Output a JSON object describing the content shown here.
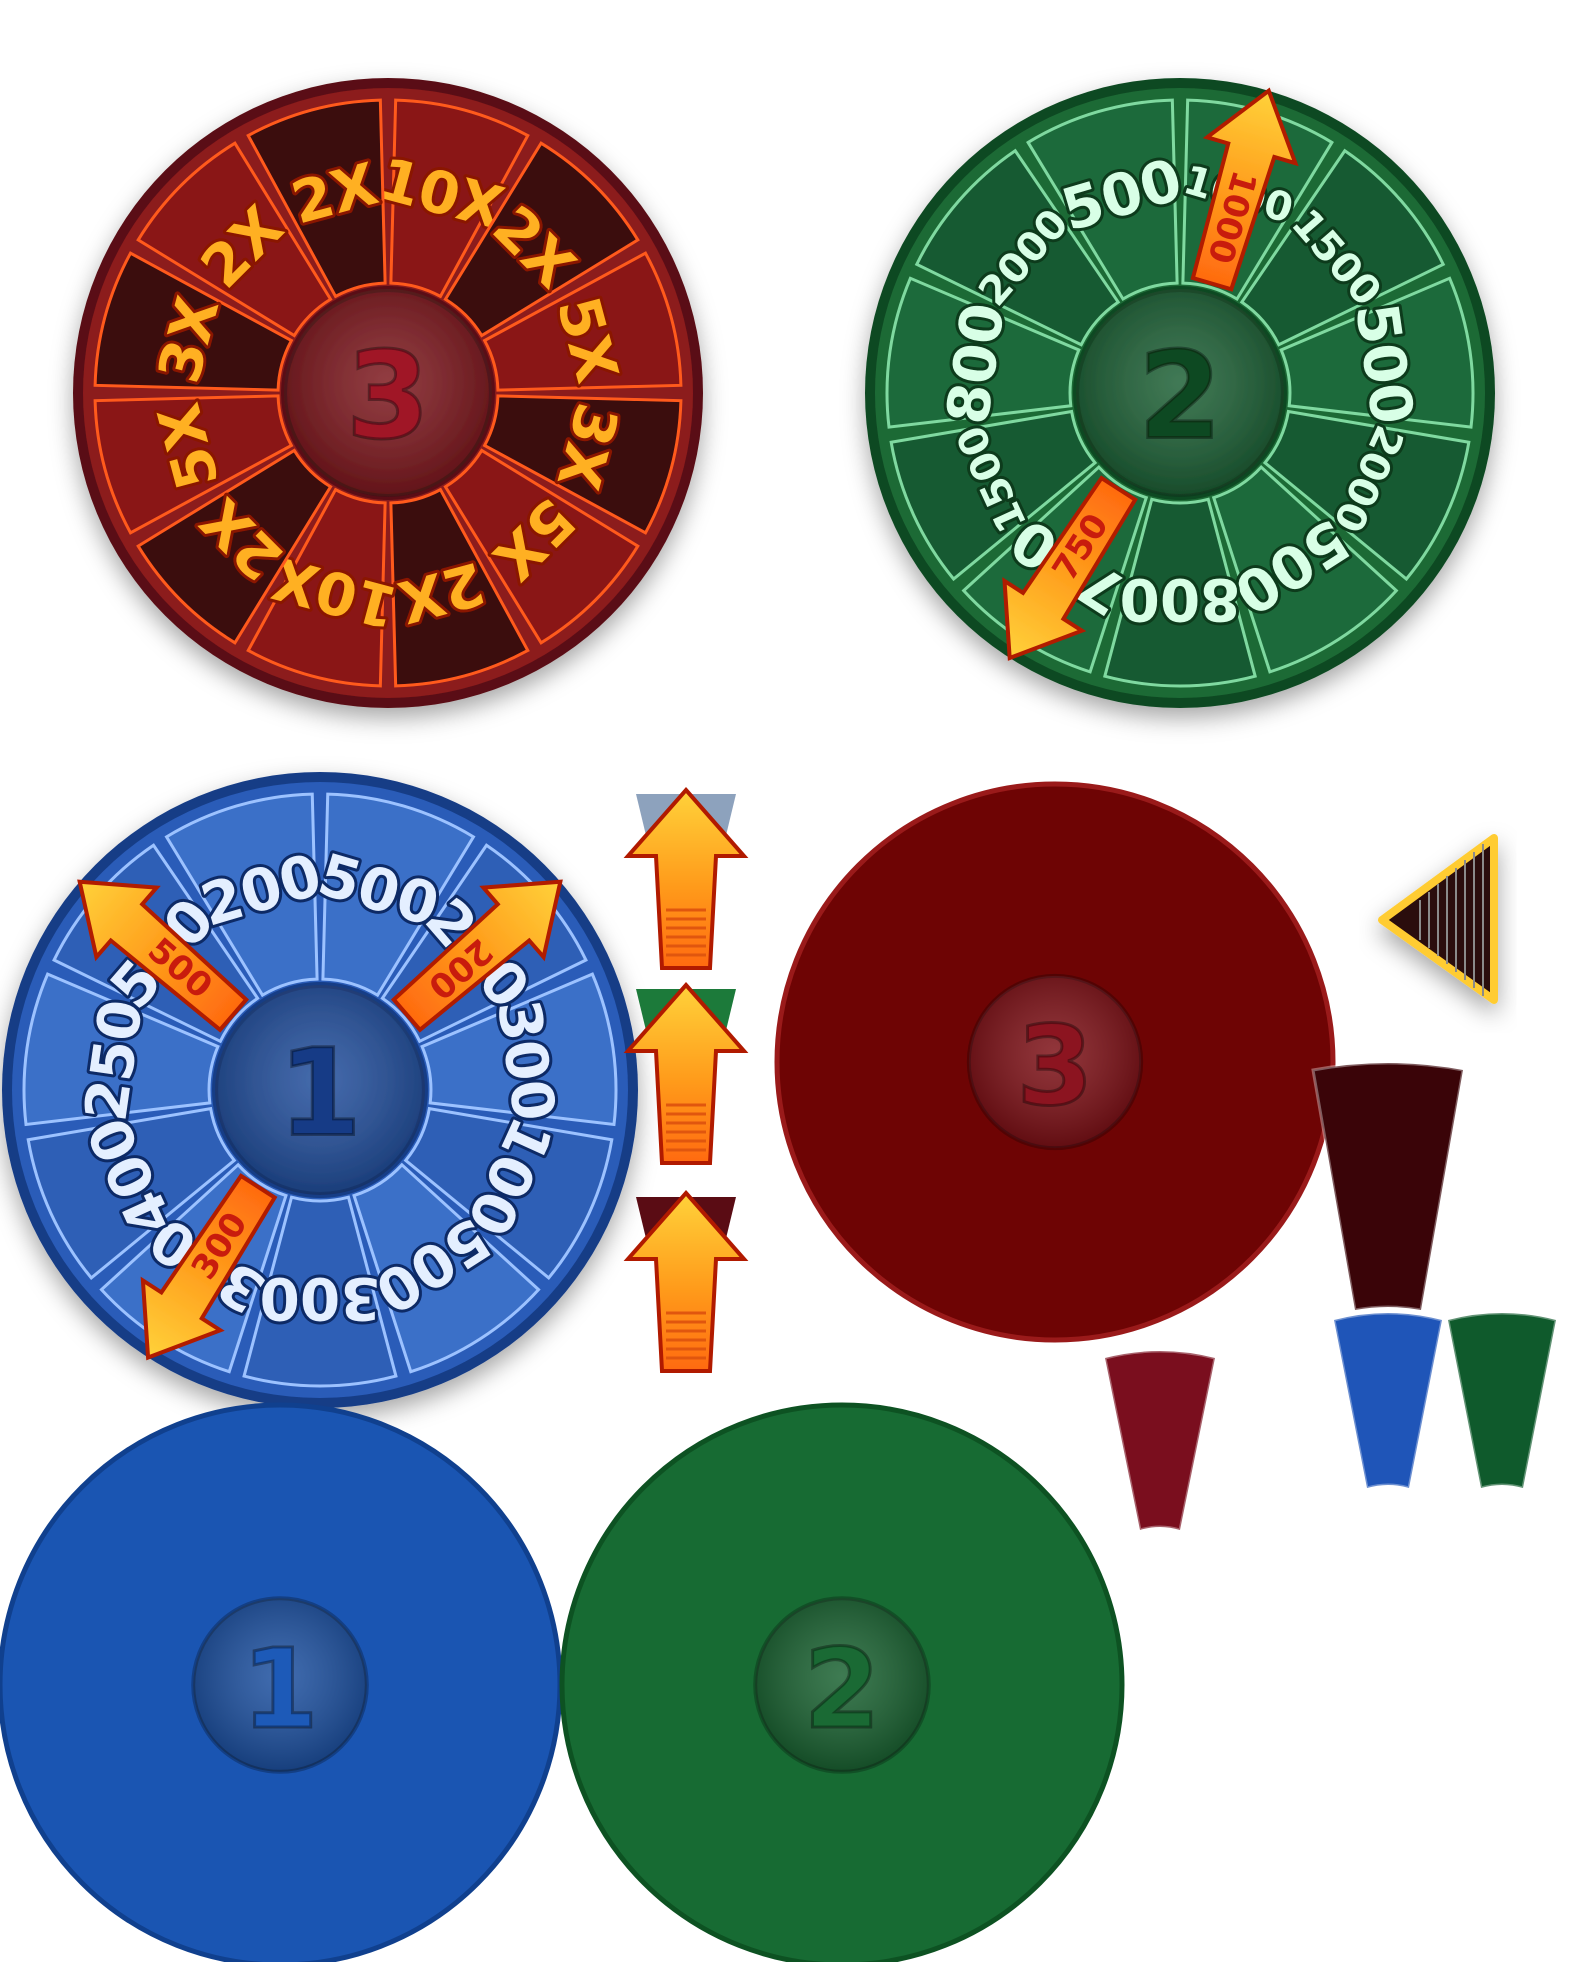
{
  "sprite_sheet": {
    "background": "#ffffff",
    "wheels": [
      {
        "id": "wheel3",
        "hub_number": "3",
        "theme": "red",
        "colors": {
          "rim": "#5a1014",
          "outer": "#8c1a1c",
          "segA": "#8a1414",
          "segB": "#3a0a0e",
          "border": "#ff5a1e",
          "hub": "#7a1218",
          "hubText": "#a01828",
          "label": "#ffb020",
          "labelStroke": "#8a1600"
        },
        "segments": [
          "10X",
          "2X",
          "5X",
          "3X",
          "5X",
          "2X",
          "10X",
          "2X",
          "5X",
          "3X",
          "2X",
          "2X"
        ],
        "pointers": []
      },
      {
        "id": "wheel2",
        "hub_number": "2",
        "theme": "green",
        "colors": {
          "rim": "#0f4a22",
          "outer": "#1d6a36",
          "segA": "#1f6b3a",
          "segB": "#175a30",
          "border": "#7fd9a0",
          "hub": "#175c30",
          "hubText": "#0e4a22",
          "label": "#d8ffe6",
          "labelStroke": "#0b3a1a"
        },
        "segments": [
          "1000",
          "1500",
          "500",
          "2000",
          "500",
          "800",
          "750",
          "1500",
          "800",
          "2000",
          "500"
        ],
        "pointers": [
          {
            "label": "1000",
            "segment": 0
          },
          {
            "label": "750",
            "segment": 6
          }
        ]
      },
      {
        "id": "wheel1",
        "hub_number": "1",
        "theme": "blue",
        "colors": {
          "rim": "#163c86",
          "outer": "#2a5cb8",
          "segA": "#3b6fc8",
          "segB": "#2f5fb6",
          "border": "#9cc2ff",
          "hub": "#1c4a9a",
          "hubText": "#123a86",
          "label": "#e4efff",
          "labelStroke": "#0d2a66"
        },
        "segments": [
          "500",
          "200",
          "300",
          "100",
          "500",
          "300",
          "300",
          "400",
          "250",
          "500",
          "200"
        ],
        "pointers": [
          {
            "label": "200",
            "segment": 1
          },
          {
            "label": "300",
            "segment": 6
          },
          {
            "label": "500",
            "segment": 9
          }
        ]
      }
    ],
    "blank_discs": [
      {
        "id": "disc3",
        "number": "3",
        "fill": "#6e0404",
        "stroke": "#9a1a1a",
        "hub": "#7a0a10",
        "numColor": "#8c1420"
      },
      {
        "id": "disc1",
        "number": "1",
        "fill": "#1a55b2",
        "stroke": "#10408e",
        "hub": "#174c9e",
        "numColor": "#1d5ab8"
      },
      {
        "id": "disc2",
        "number": "2",
        "fill": "#176b33",
        "stroke": "#0d5222",
        "hub": "#145e2c",
        "numColor": "#1a6a34"
      }
    ],
    "arrow_tiles": [
      {
        "id": "arrow-slate",
        "capColor": "#8da2bd"
      },
      {
        "id": "arrow-green",
        "capColor": "#1c7a3a"
      },
      {
        "id": "arrow-maroon",
        "capColor": "#5a0c14"
      }
    ],
    "flappers": [
      {
        "id": "flapper-dark",
        "color": "#3a0408"
      },
      {
        "id": "flapper-red",
        "color": "#7a0e1e"
      },
      {
        "id": "flapper-blue",
        "color": "#1f55b8"
      },
      {
        "id": "flapper-green",
        "color": "#0f5a2c"
      }
    ],
    "triangle_marker": {
      "fill": "#2a0a0e",
      "border": "#ffcc33"
    }
  }
}
